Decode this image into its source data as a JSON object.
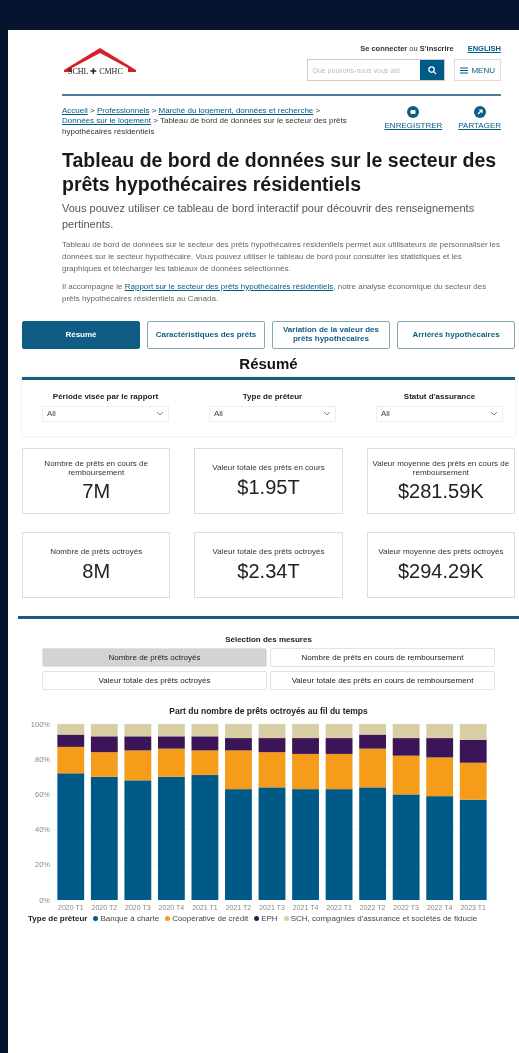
{
  "header": {
    "logo_text": "SCHL ✚ CMHC",
    "login": "Se connecter",
    "or": "ou",
    "signup": "S'inscrire",
    "language": "ENGLISH",
    "search": {
      "placeholder": "Que pouvons-nous vous aid"
    },
    "menu": "MENU"
  },
  "breadcrumb": {
    "separator": ">",
    "links": [
      "Accueil",
      "Professionnels",
      "Marché du logement, données et recherche",
      "Données sur le logement"
    ],
    "current": "Tableau de bord de données sur le secteur des prêts hypothécaires résidentiels"
  },
  "actions": [
    "ENREGISTRER",
    "PARTAGER"
  ],
  "title": "Tableau de bord de données sur le secteur des prêts hypothécaires résidentiels",
  "lead": "Vous pouvez utiliser ce tableau de bord interactif pour découvrir des renseignements pertinents.",
  "intro": "Tableau de bord de données sur le secteur des prêts hypothécaires résidentiels permet aux utilisateurs de personnaliser les données sur le secteur hypothécaire. Vous pouvez utiliser le tableau de bord pour consulter les statistiques et les graphiques et télécharger les tableaux de données sélectionnés.",
  "report": {
    "before": "Il accompagne le",
    "link": "Rapport sur le secteur des prêts hypothécaires résidentiels",
    "after": ", notre analyse économique du secteur des prêts hypothécaires résidentiels au Canada."
  },
  "tabs": [
    {
      "label": "Résumé",
      "selected": true
    },
    {
      "label": "Caractéristiques des prêts",
      "selected": false
    },
    {
      "label": "Variation de la valeur des prêts hypothécaires",
      "selected": false
    },
    {
      "label": "Arriérés hypothécaires",
      "selected": false
    }
  ],
  "section_title": "Résumé",
  "filters": [
    {
      "label": "Période visée par le rapport",
      "value": "All"
    },
    {
      "label": "Type de prêteur",
      "value": "All"
    },
    {
      "label": "Statut d'assurance",
      "value": "All"
    }
  ],
  "cards": [
    {
      "label": "Nombre de prêts en cours de remboursement",
      "value": "7M"
    },
    {
      "label": "Valeur totale des prêts en cours",
      "value": "$1.95T"
    },
    {
      "label": "Valeur moyenne des prêts en cours de remboursement",
      "value": "$281.59K"
    },
    {
      "label": "Nombre de prêts octroyés",
      "value": "8M"
    },
    {
      "label": "Valeur totale des prêts octroyés",
      "value": "$2.34T"
    },
    {
      "label": "Valeur moyenne des prêts octroyés",
      "value": "$294.29K"
    }
  ],
  "measures": {
    "title": "Sélection des mesures",
    "options": [
      {
        "label": "Nombre de prêts octroyés",
        "selected": true
      },
      {
        "label": "Nombre de prêts en cours de remboursement",
        "selected": false
      },
      {
        "label": "Valeur totale des prêts octroyés",
        "selected": false
      },
      {
        "label": "Valeur totale des prêts en cours de remboursement",
        "selected": false
      }
    ]
  },
  "chart": {
    "legend_title": "Type de prêteur",
    "chart_data": {
      "type": "bar",
      "title": "Part du nombre de prêts octroyés au fil du temps",
      "stacked": true,
      "categories": [
        "2020 T1",
        "2020 T2",
        "2020 T3",
        "2020 T4",
        "2021 T1",
        "2021 T2",
        "2021 T3",
        "2021 T4",
        "2022 T1",
        "2022 T2",
        "2022 T3",
        "2022 T4",
        "2023 T1"
      ],
      "ylim": [
        0,
        100
      ],
      "yticks": [
        {
          "value": 0,
          "label": "0%"
        },
        {
          "value": 20,
          "label": "20%"
        },
        {
          "value": 40,
          "label": "40%"
        },
        {
          "value": 60,
          "label": "60%"
        },
        {
          "value": 80,
          "label": "80%"
        },
        {
          "value": 100,
          "label": "100%"
        }
      ],
      "series": [
        {
          "name": "Banque à charte",
          "color": "#005a87",
          "values": [
            72,
            70,
            68,
            70,
            71,
            63,
            64,
            63,
            63,
            64,
            60,
            59,
            57
          ]
        },
        {
          "name": "Coopérative de crédit",
          "color": "#f59c1a",
          "values": [
            15,
            14,
            17,
            16,
            14,
            22,
            20,
            20,
            20,
            22,
            22,
            22,
            21
          ]
        },
        {
          "name": "EPH",
          "color": "#3b1557",
          "values": [
            7,
            9,
            8,
            7,
            8,
            7,
            8,
            9,
            9,
            8,
            10,
            11,
            13
          ]
        },
        {
          "name": "SCH, compagnies d'assurance et sociétés de fiducie",
          "color": "#d7cfa3",
          "values": [
            6,
            7,
            7,
            7,
            7,
            8,
            8,
            8,
            8,
            6,
            8,
            8,
            9
          ]
        }
      ]
    }
  }
}
